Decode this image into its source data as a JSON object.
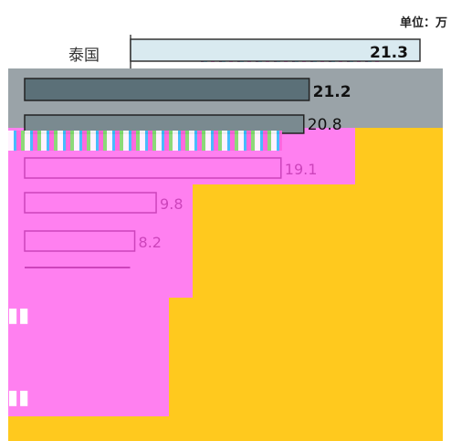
{
  "unit_text": "单位：万",
  "chart_data": {
    "type": "bar",
    "orientation": "horizontal",
    "unit": "万",
    "categories": [
      "泰国",
      "",
      "",
      "",
      "",
      "",
      ""
    ],
    "values": [
      21.3,
      21.2,
      20.8,
      19.1,
      9.8,
      8.2,
      7.0
    ],
    "value_labels": [
      "21.3",
      "21.2",
      "20.8",
      "19.1",
      "9.8",
      "8.2",
      ""
    ],
    "xlim": [
      0,
      22
    ]
  }
}
